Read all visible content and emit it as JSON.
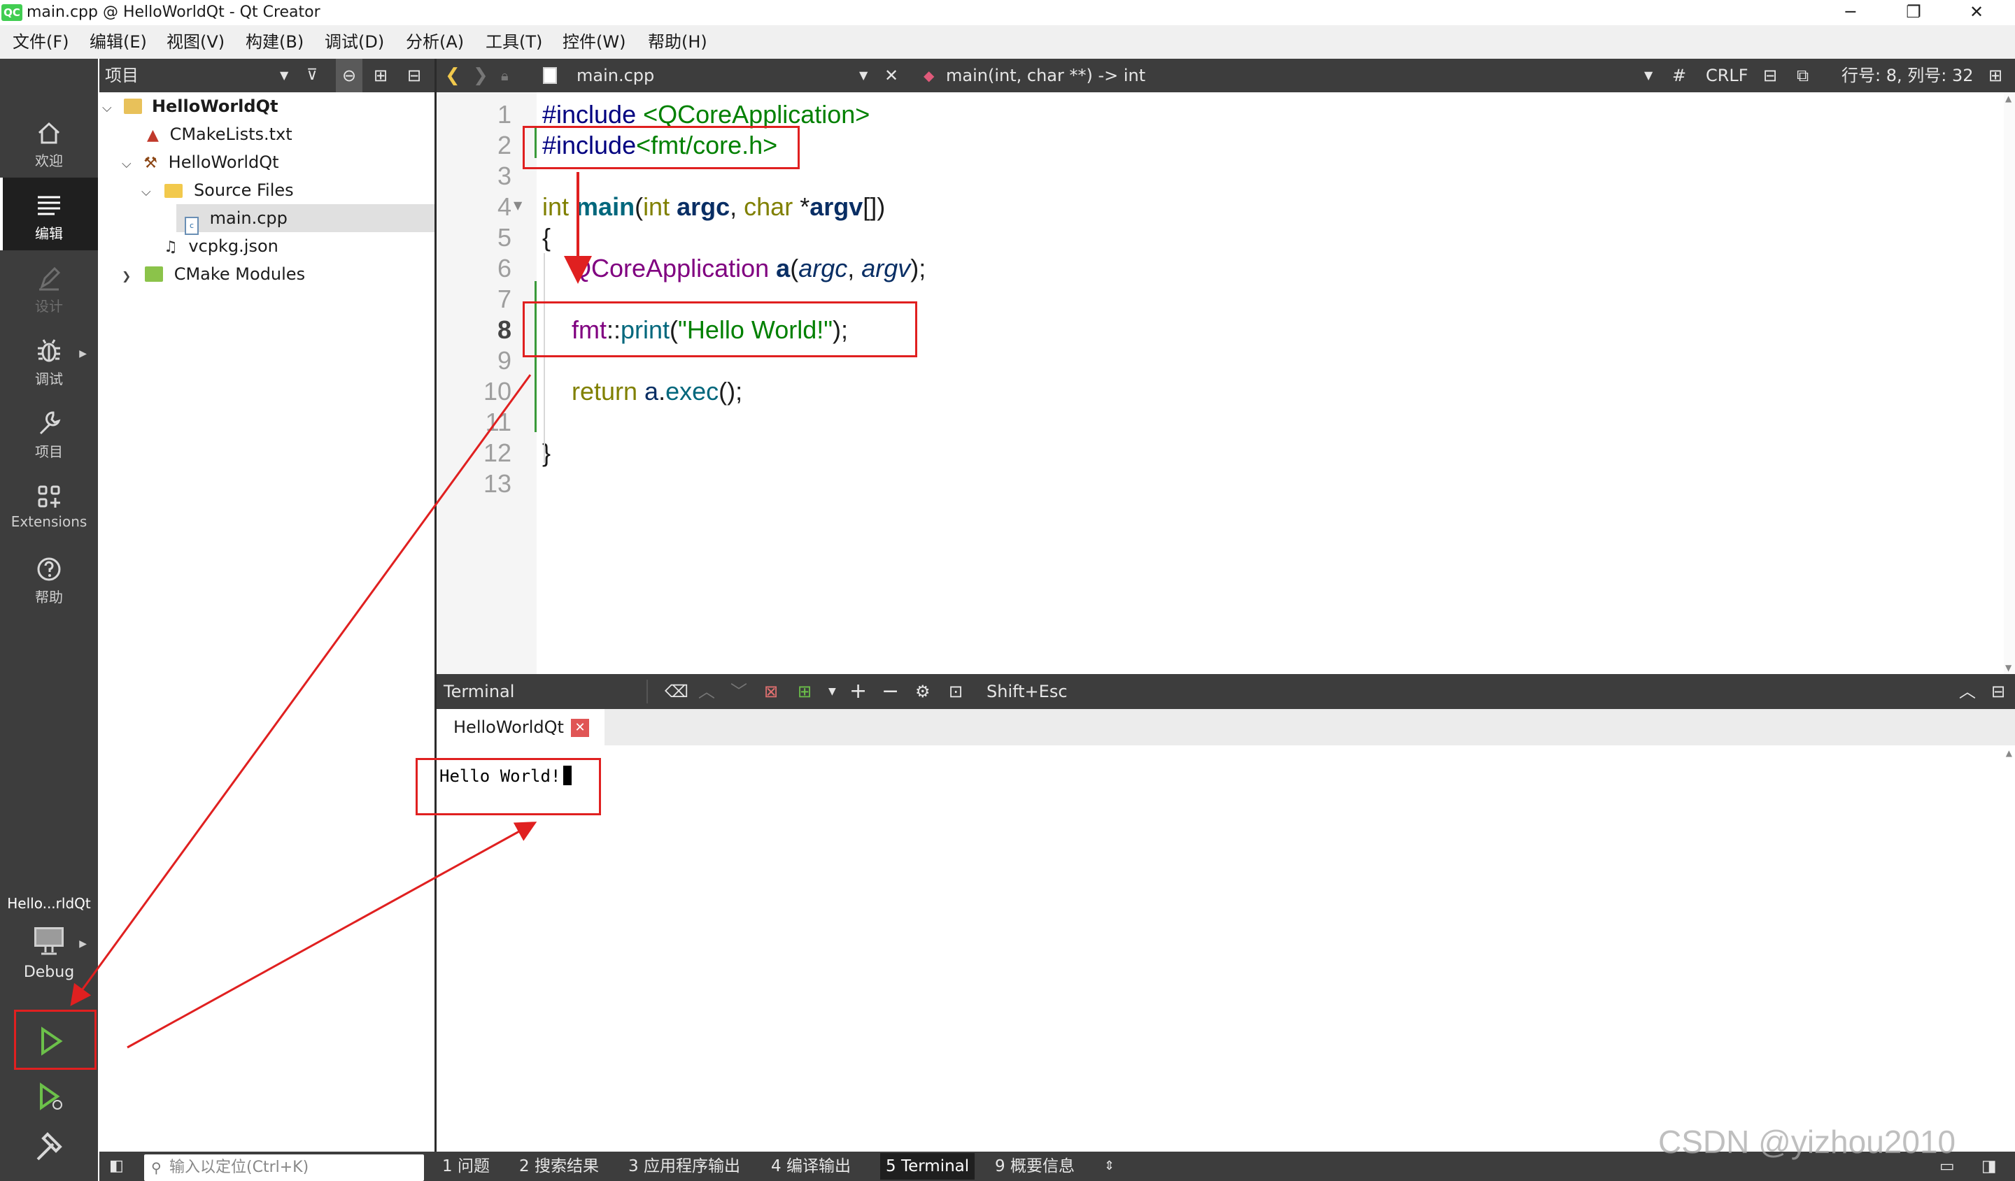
{
  "window": {
    "title": "main.cpp @ HelloWorldQt - Qt Creator",
    "logo": "QC"
  },
  "menu": [
    "文件(F)",
    "编辑(E)",
    "视图(V)",
    "构建(B)",
    "调试(D)",
    "分析(A)",
    "工具(T)",
    "控件(W)",
    "帮助(H)"
  ],
  "modes": [
    {
      "label": "欢迎",
      "icon": "home-icon"
    },
    {
      "label": "编辑",
      "icon": "edit-icon"
    },
    {
      "label": "设计",
      "icon": "design-icon"
    },
    {
      "label": "调试",
      "icon": "debug-icon"
    },
    {
      "label": "项目",
      "icon": "wrench-icon"
    },
    {
      "label": "Extensions",
      "icon": "extensions-icon"
    },
    {
      "label": "帮助",
      "icon": "help-icon"
    }
  ],
  "kit": {
    "project": "Hello...rldQt",
    "config": "Debug"
  },
  "project_panel": {
    "title": "项目",
    "tree": [
      {
        "label": "HelloWorldQt",
        "bold": true
      },
      {
        "label": "CMakeLists.txt"
      },
      {
        "label": "HelloWorldQt"
      },
      {
        "label": "Source Files"
      },
      {
        "label": "main.cpp"
      },
      {
        "label": "vcpkg.json"
      },
      {
        "label": "CMake Modules"
      }
    ]
  },
  "editor": {
    "file": "main.cpp",
    "symbol": "main(int, char **) -> int",
    "hash": "#",
    "line_ending": "CRLF",
    "position": "行号: 8, 列号: 32",
    "line_numbers": [
      "1",
      "2",
      "3",
      "4",
      "5",
      "6",
      "7",
      "8",
      "9",
      "10",
      "11",
      "12",
      "13"
    ],
    "code": {
      "l1_kw": "#include ",
      "l1_inc": "<QCoreApplication>",
      "l2_kw": "#include",
      "l2_inc": "<fmt/core.h>",
      "l4_type": "int ",
      "l4_fn": "main",
      "l4_p1": "(",
      "l4_t2": "int ",
      "l4_a": "argc",
      "l4_c": ", ",
      "l4_t3": "char ",
      "l4_star": "*",
      "l4_b": "argv",
      "l4_end": "[])",
      "l5": "{",
      "l6_cls": "QCoreApplication ",
      "l6_var": "a",
      "l6_p": "(",
      "l6_a": "argc",
      "l6_c": ", ",
      "l6_b": "argv",
      "l6_end": ");",
      "l8_ns": "fmt",
      "l8_sep": "::",
      "l8_fn": "print",
      "l8_p": "(",
      "l8_str": "\"Hello World!\"",
      "l8_end": ");",
      "l10_kw": "return ",
      "l10_var": "a",
      "l10_dot": ".",
      "l10_fn": "exec",
      "l10_end": "();",
      "l12": "}"
    }
  },
  "terminal": {
    "title": "Terminal",
    "shortcut": "Shift+Esc",
    "tab": "HelloWorldQt",
    "output": "Hello World!"
  },
  "status": {
    "search_placeholder": "输入以定位(Ctrl+K)",
    "tabs": [
      "1  问题",
      "2  搜索结果",
      "3  应用程序输出",
      "4  编译输出",
      "5  Terminal",
      "9  概要信息"
    ],
    "active_tab": "5  Terminal"
  },
  "watermark": "CSDN @yizhou2010",
  "colors": {
    "keyword": "#808000",
    "preproc": "#000080",
    "include": "#008000",
    "type_class": "#800080",
    "function": "#00677c",
    "string": "#008000",
    "annotation": "#e02020"
  }
}
